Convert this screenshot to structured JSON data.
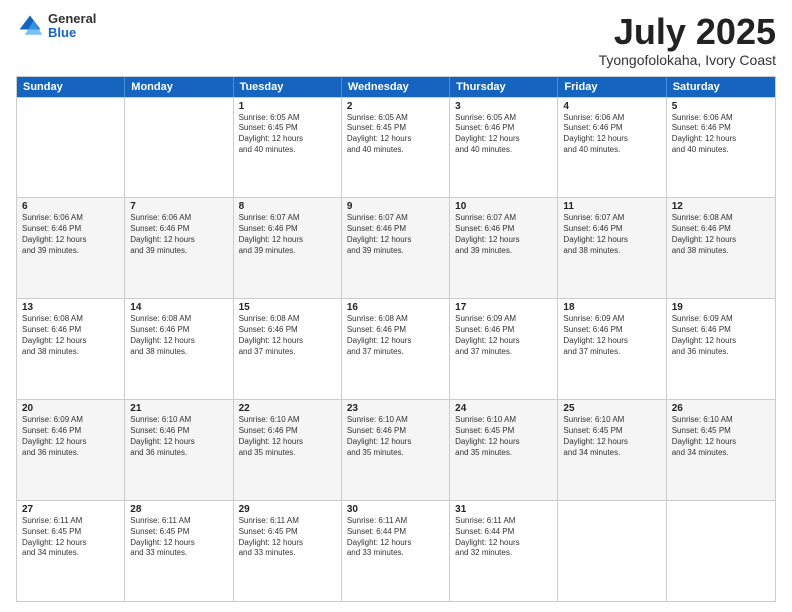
{
  "header": {
    "logo_general": "General",
    "logo_blue": "Blue",
    "title": "July 2025",
    "location": "Tyongofolokaha, Ivory Coast"
  },
  "days_of_week": [
    "Sunday",
    "Monday",
    "Tuesday",
    "Wednesday",
    "Thursday",
    "Friday",
    "Saturday"
  ],
  "rows": [
    {
      "alt": false,
      "cells": [
        {
          "day": "",
          "lines": []
        },
        {
          "day": "",
          "lines": []
        },
        {
          "day": "1",
          "lines": [
            "Sunrise: 6:05 AM",
            "Sunset: 6:45 PM",
            "Daylight: 12 hours",
            "and 40 minutes."
          ]
        },
        {
          "day": "2",
          "lines": [
            "Sunrise: 6:05 AM",
            "Sunset: 6:45 PM",
            "Daylight: 12 hours",
            "and 40 minutes."
          ]
        },
        {
          "day": "3",
          "lines": [
            "Sunrise: 6:05 AM",
            "Sunset: 6:46 PM",
            "Daylight: 12 hours",
            "and 40 minutes."
          ]
        },
        {
          "day": "4",
          "lines": [
            "Sunrise: 6:06 AM",
            "Sunset: 6:46 PM",
            "Daylight: 12 hours",
            "and 40 minutes."
          ]
        },
        {
          "day": "5",
          "lines": [
            "Sunrise: 6:06 AM",
            "Sunset: 6:46 PM",
            "Daylight: 12 hours",
            "and 40 minutes."
          ]
        }
      ]
    },
    {
      "alt": true,
      "cells": [
        {
          "day": "6",
          "lines": [
            "Sunrise: 6:06 AM",
            "Sunset: 6:46 PM",
            "Daylight: 12 hours",
            "and 39 minutes."
          ]
        },
        {
          "day": "7",
          "lines": [
            "Sunrise: 6:06 AM",
            "Sunset: 6:46 PM",
            "Daylight: 12 hours",
            "and 39 minutes."
          ]
        },
        {
          "day": "8",
          "lines": [
            "Sunrise: 6:07 AM",
            "Sunset: 6:46 PM",
            "Daylight: 12 hours",
            "and 39 minutes."
          ]
        },
        {
          "day": "9",
          "lines": [
            "Sunrise: 6:07 AM",
            "Sunset: 6:46 PM",
            "Daylight: 12 hours",
            "and 39 minutes."
          ]
        },
        {
          "day": "10",
          "lines": [
            "Sunrise: 6:07 AM",
            "Sunset: 6:46 PM",
            "Daylight: 12 hours",
            "and 39 minutes."
          ]
        },
        {
          "day": "11",
          "lines": [
            "Sunrise: 6:07 AM",
            "Sunset: 6:46 PM",
            "Daylight: 12 hours",
            "and 38 minutes."
          ]
        },
        {
          "day": "12",
          "lines": [
            "Sunrise: 6:08 AM",
            "Sunset: 6:46 PM",
            "Daylight: 12 hours",
            "and 38 minutes."
          ]
        }
      ]
    },
    {
      "alt": false,
      "cells": [
        {
          "day": "13",
          "lines": [
            "Sunrise: 6:08 AM",
            "Sunset: 6:46 PM",
            "Daylight: 12 hours",
            "and 38 minutes."
          ]
        },
        {
          "day": "14",
          "lines": [
            "Sunrise: 6:08 AM",
            "Sunset: 6:46 PM",
            "Daylight: 12 hours",
            "and 38 minutes."
          ]
        },
        {
          "day": "15",
          "lines": [
            "Sunrise: 6:08 AM",
            "Sunset: 6:46 PM",
            "Daylight: 12 hours",
            "and 37 minutes."
          ]
        },
        {
          "day": "16",
          "lines": [
            "Sunrise: 6:08 AM",
            "Sunset: 6:46 PM",
            "Daylight: 12 hours",
            "and 37 minutes."
          ]
        },
        {
          "day": "17",
          "lines": [
            "Sunrise: 6:09 AM",
            "Sunset: 6:46 PM",
            "Daylight: 12 hours",
            "and 37 minutes."
          ]
        },
        {
          "day": "18",
          "lines": [
            "Sunrise: 6:09 AM",
            "Sunset: 6:46 PM",
            "Daylight: 12 hours",
            "and 37 minutes."
          ]
        },
        {
          "day": "19",
          "lines": [
            "Sunrise: 6:09 AM",
            "Sunset: 6:46 PM",
            "Daylight: 12 hours",
            "and 36 minutes."
          ]
        }
      ]
    },
    {
      "alt": true,
      "cells": [
        {
          "day": "20",
          "lines": [
            "Sunrise: 6:09 AM",
            "Sunset: 6:46 PM",
            "Daylight: 12 hours",
            "and 36 minutes."
          ]
        },
        {
          "day": "21",
          "lines": [
            "Sunrise: 6:10 AM",
            "Sunset: 6:46 PM",
            "Daylight: 12 hours",
            "and 36 minutes."
          ]
        },
        {
          "day": "22",
          "lines": [
            "Sunrise: 6:10 AM",
            "Sunset: 6:46 PM",
            "Daylight: 12 hours",
            "and 35 minutes."
          ]
        },
        {
          "day": "23",
          "lines": [
            "Sunrise: 6:10 AM",
            "Sunset: 6:46 PM",
            "Daylight: 12 hours",
            "and 35 minutes."
          ]
        },
        {
          "day": "24",
          "lines": [
            "Sunrise: 6:10 AM",
            "Sunset: 6:45 PM",
            "Daylight: 12 hours",
            "and 35 minutes."
          ]
        },
        {
          "day": "25",
          "lines": [
            "Sunrise: 6:10 AM",
            "Sunset: 6:45 PM",
            "Daylight: 12 hours",
            "and 34 minutes."
          ]
        },
        {
          "day": "26",
          "lines": [
            "Sunrise: 6:10 AM",
            "Sunset: 6:45 PM",
            "Daylight: 12 hours",
            "and 34 minutes."
          ]
        }
      ]
    },
    {
      "alt": false,
      "cells": [
        {
          "day": "27",
          "lines": [
            "Sunrise: 6:11 AM",
            "Sunset: 6:45 PM",
            "Daylight: 12 hours",
            "and 34 minutes."
          ]
        },
        {
          "day": "28",
          "lines": [
            "Sunrise: 6:11 AM",
            "Sunset: 6:45 PM",
            "Daylight: 12 hours",
            "and 33 minutes."
          ]
        },
        {
          "day": "29",
          "lines": [
            "Sunrise: 6:11 AM",
            "Sunset: 6:45 PM",
            "Daylight: 12 hours",
            "and 33 minutes."
          ]
        },
        {
          "day": "30",
          "lines": [
            "Sunrise: 6:11 AM",
            "Sunset: 6:44 PM",
            "Daylight: 12 hours",
            "and 33 minutes."
          ]
        },
        {
          "day": "31",
          "lines": [
            "Sunrise: 6:11 AM",
            "Sunset: 6:44 PM",
            "Daylight: 12 hours",
            "and 32 minutes."
          ]
        },
        {
          "day": "",
          "lines": []
        },
        {
          "day": "",
          "lines": []
        }
      ]
    }
  ]
}
